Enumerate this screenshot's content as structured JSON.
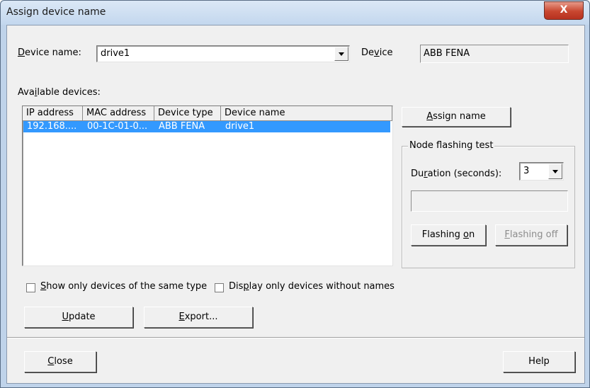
{
  "window": {
    "title": "Assign device name",
    "close_glyph": "X"
  },
  "device_name": {
    "label_prefix": "",
    "label_u": "D",
    "label_rest": "evice name:",
    "value": "drive1"
  },
  "device": {
    "label_pre": "De",
    "label_u": "v",
    "label_post": "ice",
    "value": "ABB FENA"
  },
  "available": {
    "label_pre": "Ava",
    "label_u": "i",
    "label_post": "lable devices:"
  },
  "table": {
    "columns": [
      "IP address",
      "MAC address",
      "Device type",
      "Device name"
    ],
    "rows": [
      {
        "ip": "192.168....",
        "mac": "00-1C-01-0...",
        "type": "ABB FENA",
        "name": "drive1"
      }
    ]
  },
  "assign_button": {
    "u": "A",
    "rest": "ssign name"
  },
  "flashing": {
    "group_label": "Node flashing test",
    "duration_pre": "Du",
    "duration_u": "r",
    "duration_post": "ation (seconds):",
    "duration_value": "3",
    "on_pre": "Flashing ",
    "on_u": "o",
    "on_post": "n",
    "off_u": "F",
    "off_rest": "lashing off"
  },
  "checkboxes": {
    "same_type_u": "S",
    "same_type_rest": "how only devices of the same type",
    "no_names_pre": "Dis",
    "no_names_u": "p",
    "no_names_post": "lay only devices without names"
  },
  "buttons": {
    "update_u": "U",
    "update_rest": "pdate",
    "export_u": "E",
    "export_rest": "xport...",
    "close_u": "C",
    "close_rest": "lose",
    "help": "Help"
  },
  "colors": {
    "selection": "#3399ff",
    "titlebar": "#c3d7ee",
    "close_red": "#c8462f"
  }
}
